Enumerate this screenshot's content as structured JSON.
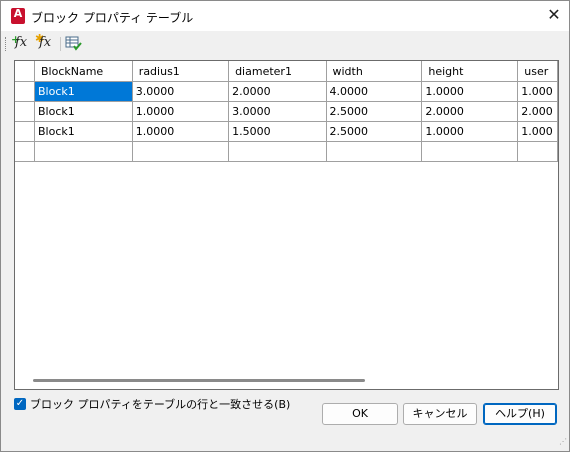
{
  "window": {
    "title": "ブロック プロパティ テーブル",
    "close_glyph": "✕",
    "app_icon_letter": "A"
  },
  "toolbar": {
    "add_parameter_label": "fx",
    "add_user_parameter_label": "fx",
    "audit_icon": "table-check-icon"
  },
  "table": {
    "columns": [
      "BlockName",
      "radius1",
      "diameter1",
      "width",
      "height",
      "user"
    ],
    "rows": [
      [
        "Block1",
        "3.0000",
        "2.0000",
        "4.0000",
        "1.0000",
        "1.000"
      ],
      [
        "Block1",
        "1.0000",
        "3.0000",
        "2.5000",
        "2.0000",
        "2.000"
      ],
      [
        "Block1",
        "1.0000",
        "1.5000",
        "2.5000",
        "1.0000",
        "1.000"
      ]
    ],
    "selected_cell": "Block1"
  },
  "match_checkbox": {
    "label": "ブロック プロパティをテーブルの行と一致させる(B)",
    "checked": true
  },
  "buttons": {
    "ok": "OK",
    "cancel": "キャンセル",
    "help": "ヘルプ(H)"
  },
  "colors": {
    "selection": "#0078d7",
    "accent": "#0067c0",
    "app_icon": "#c8102e"
  }
}
